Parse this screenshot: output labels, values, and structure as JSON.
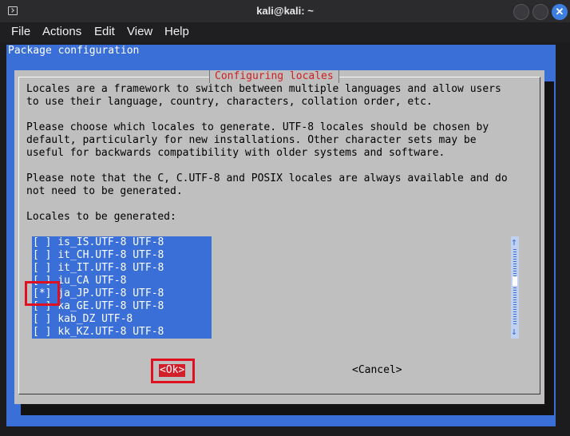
{
  "window": {
    "title": "kali@kali: ~",
    "close_glyph": "✕"
  },
  "menu": [
    "File",
    "Actions",
    "Edit",
    "View",
    "Help"
  ],
  "package_config_title": "Package configuration",
  "dialog": {
    "title": "Configuring locales",
    "lines": [
      "Locales are a framework to switch between multiple languages and allow users",
      "to use their language, country, characters, collation order, etc.",
      "",
      "Please choose which locales to generate. UTF-8 locales should be chosen by",
      "default, particularly for new installations. Other character sets may be",
      "useful for backwards compatibility with older systems and software.",
      "",
      "Please note that the C, C.UTF-8 and POSIX locales are always available and do",
      "not need to be generated.",
      "",
      "Locales to be generated:"
    ],
    "locales": [
      {
        "check": "[ ]",
        "label": "is_IS.UTF-8 UTF-8",
        "checked": false
      },
      {
        "check": "[ ]",
        "label": "it_CH.UTF-8 UTF-8",
        "checked": false
      },
      {
        "check": "[ ]",
        "label": "it_IT.UTF-8 UTF-8",
        "checked": false
      },
      {
        "check": "[ ]",
        "label": "iu_CA UTF-8",
        "checked": false
      },
      {
        "check": "[*]",
        "label": "ja_JP.UTF-8 UTF-8",
        "checked": true
      },
      {
        "check": "[ ]",
        "label": "ka_GE.UTF-8 UTF-8",
        "checked": false
      },
      {
        "check": "[ ]",
        "label": "kab_DZ UTF-8",
        "checked": false
      },
      {
        "check": "[ ]",
        "label": "kk_KZ.UTF-8 UTF-8",
        "checked": false
      }
    ],
    "scroll_up": "↑",
    "scroll_down": "↓",
    "ok_label": "<Ok>",
    "cancel_label": "<Cancel>"
  },
  "colors": {
    "accent_blue": "#3a6fd8",
    "dialog_gray": "#bfbfbf",
    "title_red": "#d02020",
    "highlight_red": "#e01020"
  }
}
